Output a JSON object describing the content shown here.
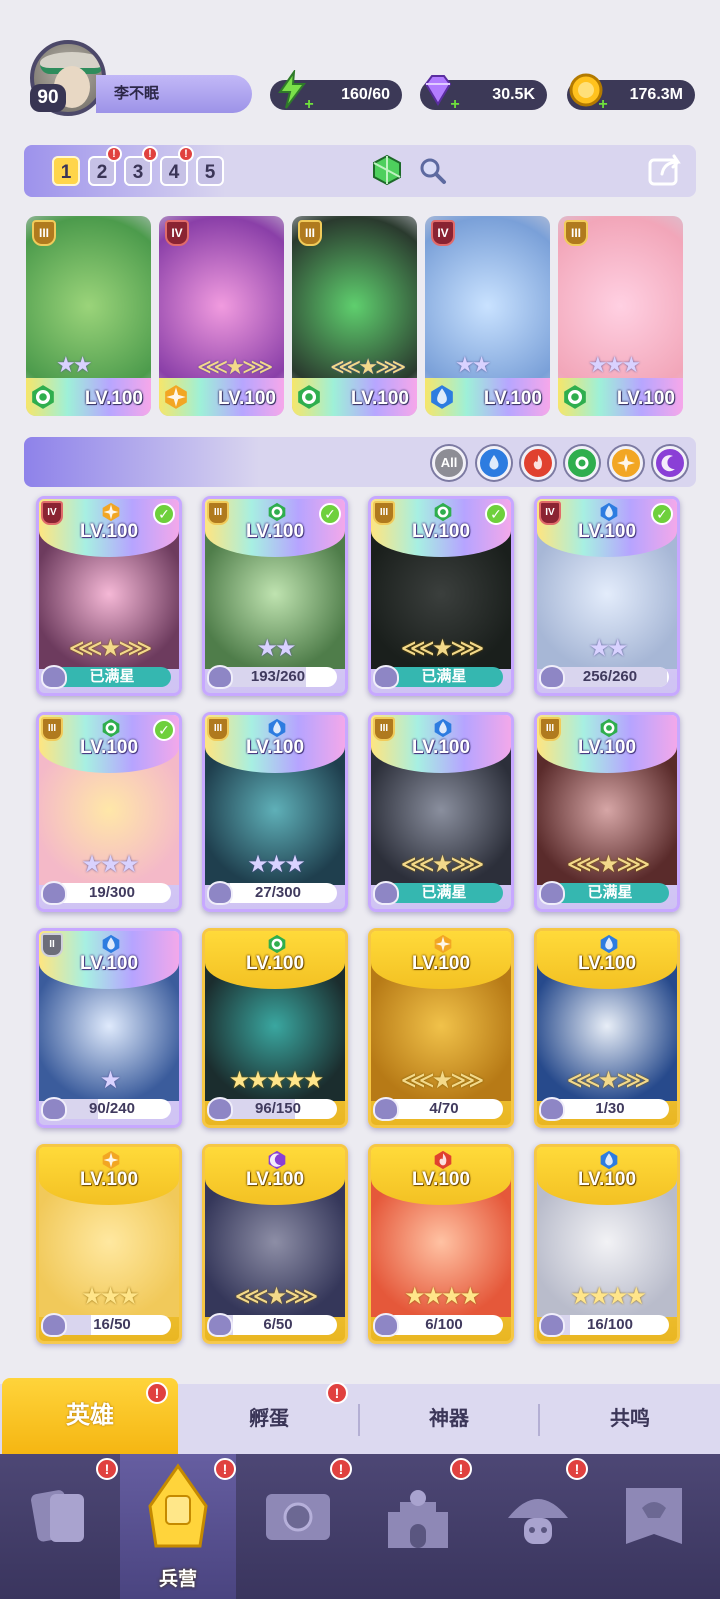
{
  "player": {
    "level": "90",
    "name": "李不眠"
  },
  "resources": {
    "energy": "160/60",
    "gems": "30.5K",
    "coins": "176.3M"
  },
  "teams": {
    "tabs": [
      "1",
      "2",
      "3",
      "4",
      "5"
    ],
    "selected_index": 0,
    "badged": [
      1,
      2,
      3
    ],
    "badge_glyph": "!"
  },
  "team_heroes": [
    {
      "rank": "III",
      "stars": 2,
      "element": "wind",
      "level": "LV.100",
      "colors": [
        "#9bd47a",
        "#4c9b4c"
      ]
    },
    {
      "rank": "IV",
      "stars": 0,
      "element": "light",
      "level": "LV.100",
      "colors": [
        "#f19bdf",
        "#8a3fa8"
      ]
    },
    {
      "rank": "III",
      "stars": 0,
      "element": "wind",
      "level": "LV.100",
      "colors": [
        "#5fcf6e",
        "#2a3a2e"
      ]
    },
    {
      "rank": "IV",
      "stars": 2,
      "element": "water",
      "level": "LV.100",
      "colors": [
        "#c9e2ff",
        "#7aa0d8"
      ]
    },
    {
      "rank": "III",
      "stars": 3,
      "element": "wind",
      "level": "LV.100",
      "colors": [
        "#ffd0e2",
        "#f2a6b9"
      ]
    }
  ],
  "filters": {
    "all_label": "All",
    "elements": [
      "water",
      "fire",
      "wind",
      "light",
      "dark"
    ]
  },
  "element_colors": {
    "wind": "#2fae4e",
    "water": "#2d7ce0",
    "fire": "#e0412f",
    "light": "#f2a623",
    "dark": "#8a3fd6"
  },
  "heroes": [
    {
      "rank": "IV",
      "element": "light",
      "level": "LV.100",
      "checked": true,
      "stars": 0,
      "progress": "已满星",
      "max": true,
      "frame": "purple",
      "art": [
        "#f5b8d6",
        "#6d3b5e"
      ]
    },
    {
      "rank": "III",
      "element": "wind",
      "level": "LV.100",
      "checked": true,
      "stars": 2,
      "progress": "193/260",
      "fill": 0.74,
      "frame": "purple",
      "art": [
        "#bfe3b0",
        "#4f7d4a"
      ]
    },
    {
      "rank": "III",
      "element": "wind",
      "level": "LV.100",
      "checked": true,
      "stars": 0,
      "progress": "已满星",
      "max": true,
      "frame": "purple",
      "art": [
        "#3b3f3d",
        "#1a1f1c"
      ]
    },
    {
      "rank": "IV",
      "element": "water",
      "level": "LV.100",
      "checked": true,
      "stars": 2,
      "progress": "256/260",
      "fill": 0.98,
      "frame": "purple",
      "art": [
        "#e3ecfb",
        "#a7b7d6"
      ]
    },
    {
      "rank": "III",
      "element": "wind",
      "level": "LV.100",
      "checked": true,
      "stars": 3,
      "progress": "19/300",
      "fill": 0.06,
      "frame": "purple",
      "art": [
        "#ffe7a8",
        "#f4b9c8"
      ]
    },
    {
      "rank": "III",
      "element": "water",
      "level": "LV.100",
      "checked": false,
      "stars": 3,
      "progress": "27/300",
      "fill": 0.09,
      "frame": "purple",
      "art": [
        "#5fb0b8",
        "#1f3f4e"
      ]
    },
    {
      "rank": "III",
      "element": "water",
      "level": "LV.100",
      "checked": false,
      "stars": 0,
      "progress": "已满星",
      "max": true,
      "frame": "purple",
      "art": [
        "#8a8f9e",
        "#2c2f3a"
      ]
    },
    {
      "rank": "III",
      "element": "wind",
      "level": "LV.100",
      "checked": false,
      "stars": 0,
      "progress": "已满星",
      "max": true,
      "frame": "purple",
      "art": [
        "#d6a6a6",
        "#5a2b2b"
      ]
    },
    {
      "rank": "II",
      "element": "water",
      "level": "LV.100",
      "checked": false,
      "stars": 1,
      "progress": "90/240",
      "fill": 0.38,
      "frame": "purple",
      "art": [
        "#dfeafc",
        "#3b5c9c"
      ]
    },
    {
      "element": "wind",
      "level": "LV.100",
      "stars": 5,
      "progress": "96/150",
      "fill": 0.64,
      "frame": "gold",
      "art": [
        "#3aa7a0",
        "#1b2d2e"
      ]
    },
    {
      "element": "light",
      "level": "LV.100",
      "stars": 0,
      "progress": "4/70",
      "fill": 0.06,
      "frame": "gold",
      "art": [
        "#f1c24a",
        "#b77a16"
      ]
    },
    {
      "element": "water",
      "level": "LV.100",
      "stars": 0,
      "progress": "1/30",
      "fill": 0.03,
      "frame": "gold",
      "art": [
        "#e8eef7",
        "#274a8c"
      ]
    },
    {
      "element": "light",
      "level": "LV.100",
      "stars": 3,
      "progress": "16/50",
      "fill": 0.32,
      "frame": "gold",
      "art": [
        "#ffe8a0",
        "#f1c95a"
      ]
    },
    {
      "element": "dark",
      "level": "LV.100",
      "stars": 0,
      "progress": "6/50",
      "fill": 0.12,
      "frame": "gold",
      "art": [
        "#8d8ea6",
        "#35375a"
      ]
    },
    {
      "element": "fire",
      "level": "LV.100",
      "stars": 4,
      "progress": "6/100",
      "fill": 0.06,
      "frame": "gold",
      "art": [
        "#ffc2a3",
        "#e5583a"
      ]
    },
    {
      "element": "water",
      "level": "LV.100",
      "stars": 4,
      "progress": "16/100",
      "fill": 0.16,
      "frame": "gold",
      "art": [
        "#f2f2f5",
        "#b9bccb"
      ]
    }
  ],
  "tabs": {
    "heroes": "英雄",
    "hatch": "孵蛋",
    "artifact": "神器",
    "resonance": "共鸣"
  },
  "nav": {
    "barracks": "兵营"
  }
}
